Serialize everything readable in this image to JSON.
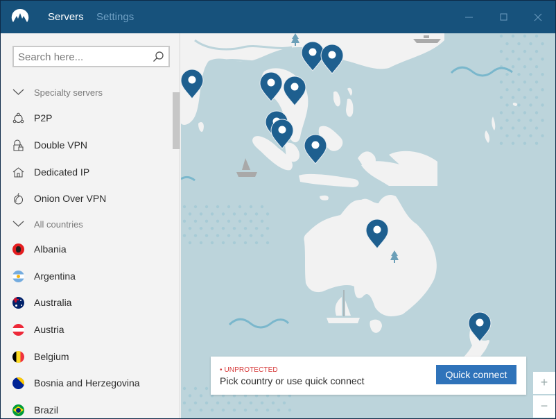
{
  "app": {
    "nav": {
      "servers": "Servers",
      "settings": "Settings"
    },
    "window_controls": {
      "minimize": "minimize",
      "maximize": "maximize",
      "close": "close"
    }
  },
  "sidebar": {
    "search": {
      "placeholder": "Search here...",
      "value": ""
    },
    "specialty_header": "Specialty servers",
    "specialty_items": [
      {
        "label": "P2P",
        "icon": "p2p-icon"
      },
      {
        "label": "Double VPN",
        "icon": "double-vpn-lock-icon"
      },
      {
        "label": "Dedicated IP",
        "icon": "home-icon"
      },
      {
        "label": "Onion Over VPN",
        "icon": "onion-icon"
      }
    ],
    "countries_header": "All countries",
    "countries": [
      {
        "label": "Albania",
        "flag": "albania-flag"
      },
      {
        "label": "Argentina",
        "flag": "argentina-flag"
      },
      {
        "label": "Australia",
        "flag": "australia-flag"
      },
      {
        "label": "Austria",
        "flag": "austria-flag"
      },
      {
        "label": "Belgium",
        "flag": "belgium-flag"
      },
      {
        "label": "Bosnia and Herzegovina",
        "flag": "bosnia-flag"
      },
      {
        "label": "Brazil",
        "flag": "brazil-flag"
      }
    ]
  },
  "status": {
    "badge": "• UNPROTECTED",
    "message": "Pick country or use quick connect",
    "quick_connect": "Quick connect"
  },
  "map_controls": {
    "zoom_in": "+",
    "zoom_out": "−"
  },
  "colors": {
    "titlebar": "#17527c",
    "pin": "#1e5f8f",
    "sea": "#bcd4db",
    "land": "#f3f3f3",
    "accent_button": "#2f73ba",
    "unprotected": "#d63a3a"
  }
}
